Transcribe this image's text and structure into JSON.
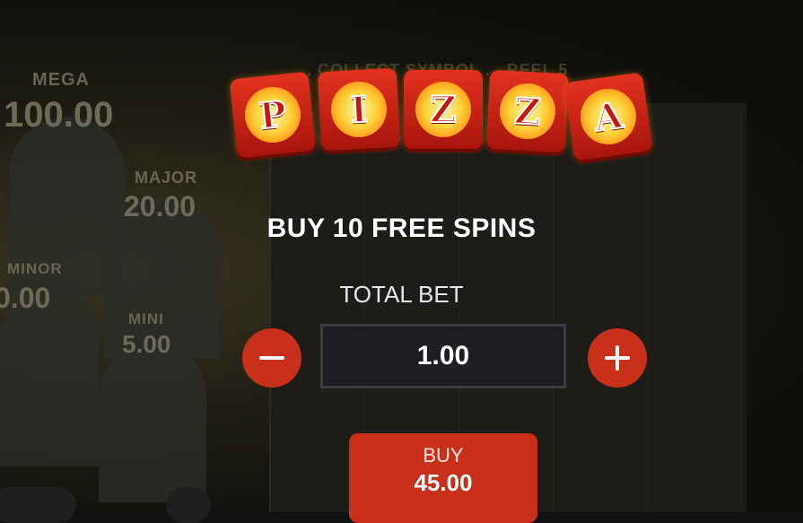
{
  "background": {
    "jackpots": [
      {
        "label": "MEGA",
        "value": "100.00"
      },
      {
        "label": "MAJOR",
        "value": "20.00"
      },
      {
        "label": "MINOR",
        "value": "0.00"
      },
      {
        "label": "MINI",
        "value": "5.00"
      }
    ],
    "reel_header": "... COLLECT SYMBOL ... REEL 5"
  },
  "dialog": {
    "logo_letters": [
      "P",
      "I",
      "Z",
      "Z",
      "A"
    ],
    "title": "BUY 10 FREE SPINS",
    "bet_label": "TOTAL BET",
    "bet_value": "1.00",
    "buy_label": "BUY",
    "buy_price": "45.00"
  },
  "colors": {
    "button_red": "#c9301c",
    "bet_box": "#1e1e22",
    "logo_red": "#e3321f"
  },
  "icons": {
    "decrease": "minus-icon",
    "increase": "plus-icon"
  }
}
